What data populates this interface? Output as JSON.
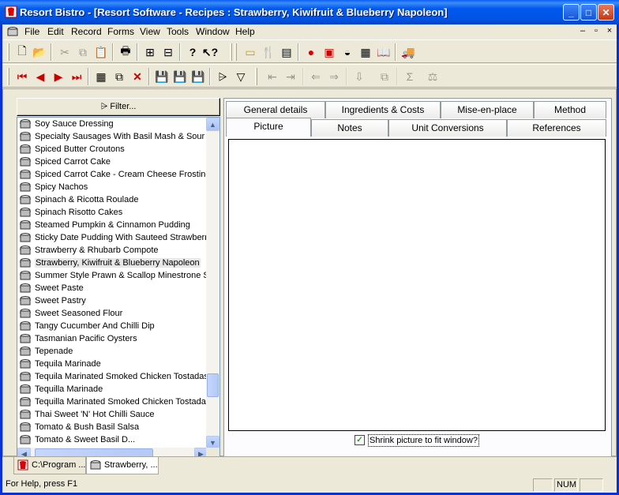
{
  "window": {
    "title": "Resort Bistro - [Resort Software - Recipes : Strawberry, Kiwifruit & Blueberry Napoleon]",
    "minimize": "_",
    "maximize": "□",
    "close": "✕"
  },
  "menubar": {
    "items": [
      "File",
      "Edit",
      "Record",
      "Forms",
      "View",
      "Tools",
      "Window",
      "Help"
    ],
    "mdi_controls": [
      "–",
      "▫",
      "×"
    ]
  },
  "toolbar1_icons": [
    "new-icon",
    "open-icon",
    "cut-icon",
    "copy-icon",
    "paste-icon",
    "print-icon",
    "tree-icon",
    "tree-alt-icon",
    "help-icon",
    "whats-this-icon",
    "ingredient-icon",
    "cutlery-icon",
    "menu-icon",
    "tomato-icon",
    "recipe-card-icon",
    "pot-icon",
    "calculator-icon",
    "book-icon",
    "truck-icon"
  ],
  "toolbar2_icons": [
    "first-record-icon",
    "prev-record-icon",
    "next-record-icon",
    "last-record-icon",
    "new-record-icon",
    "duplicate-record-icon",
    "delete-record-icon",
    "save-icon",
    "save-close-icon",
    "save-all-icon",
    "filter-icon",
    "funnel-icon",
    "indent-icon",
    "outdent-icon",
    "move-left-icon",
    "move-right-icon",
    "import-icon",
    "copy-form-icon",
    "sum-icon",
    "scales-icon"
  ],
  "filter_button": "Filter...",
  "recipe_list": [
    "Soy Sauce Dressing",
    "Specialty Sausages With Basil Mash & Sour Br",
    "Spiced Butter Croutons",
    "Spiced Carrot Cake",
    "Spiced Carrot Cake - Cream Cheese Frosting",
    "Spicy Nachos",
    "Spinach & Ricotta Roulade",
    "Spinach Risotto Cakes",
    "Steamed Pumpkin & Cinnamon Pudding",
    "Sticky Date Pudding With Sauteed Strawberry",
    "Strawberry & Rhubarb Compote",
    "Strawberry, Kiwifruit & Blueberry Napoleon",
    "Summer Style Prawn & Scallop Minestrone Sou",
    "Sweet Paste",
    "Sweet Pastry",
    "Sweet Seasoned Flour",
    "Tangy Cucumber And Chilli Dip",
    "Tasmanian Pacific Oysters",
    "Tepenade",
    "Tequila Marinade",
    "Tequila Marinated Smoked Chicken Tostadas",
    "Tequilla Marinade",
    "Tequilla Marinated Smoked Chicken Tostadas",
    "Thai Sweet 'N' Hot Chilli Sauce",
    "Tomato & Bush Basil Salsa",
    "Tomato & Sweet Basil D..."
  ],
  "selected_recipe": "Strawberry, Kiwifruit & Blueberry Napoleon",
  "tabs_row1": [
    "General details",
    "Ingredients & Costs",
    "Mise-en-place",
    "Method"
  ],
  "tabs_row2": [
    "Picture",
    "Notes",
    "Unit Conversions",
    "References"
  ],
  "active_tab": "Picture",
  "shrink_checkbox": {
    "label": "Shrink picture to fit window?",
    "checked": true,
    "mark": "✓"
  },
  "mdi_tabs": [
    "C:\\Program ...",
    "Strawberry, ..."
  ],
  "statusbar": {
    "help_text": "For Help, press F1",
    "num": "NUM"
  },
  "colors": {
    "titlebar": "#0054e3",
    "window_bg": "#ece9d8",
    "selection": "#e7e7e7"
  }
}
